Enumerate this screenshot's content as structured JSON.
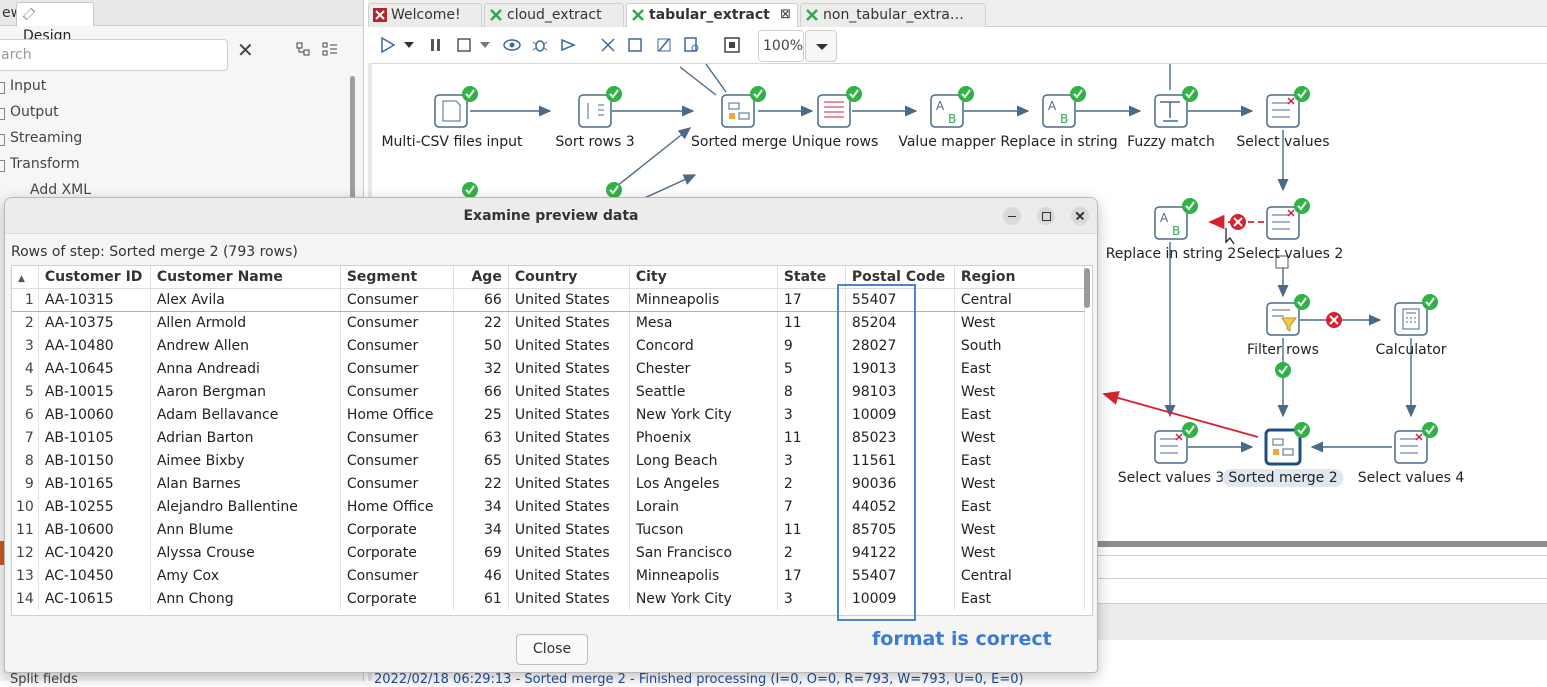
{
  "left_panel": {
    "tab_view": "ew",
    "tab_design": "Design",
    "search_placeholder": "arch",
    "tree": [
      "Input",
      "Output",
      "Streaming",
      "Transform",
      "Add XML"
    ],
    "bottom_item": "Split fields"
  },
  "tabs": [
    {
      "label": "Welcome!"
    },
    {
      "label": "cloud_extract"
    },
    {
      "label": "tabular_extract"
    },
    {
      "label": "non_tabular_extra…"
    }
  ],
  "toolbar": {
    "icons": [
      "run-icon",
      "run-dropdown-icon",
      "pause-icon",
      "stop-icon",
      "stop-dropdown-icon",
      "preview-icon",
      "debug-icon",
      "replay-icon",
      "verify-icon",
      "impact-icon",
      "sql-icon",
      "explore-db-icon",
      "grid-icon"
    ],
    "zoom": "100%"
  },
  "steps": {
    "multi_csv": "Multi-CSV files input",
    "sort_rows_3": "Sort rows 3",
    "sorted_merge": "Sorted merge",
    "unique_rows": "Unique rows",
    "value_mapper": "Value mapper",
    "replace_in_string": "Replace in string",
    "fuzzy_match": "Fuzzy match",
    "select_values": "Select values",
    "replace_in_string_2": "Replace in string 2",
    "select_values_2": "Select values 2",
    "filter_rows": "Filter rows",
    "calculator": "Calculator",
    "select_values_3": "Select values 3",
    "sorted_merge_2": "Sorted merge 2",
    "select_values_4": "Select values 4"
  },
  "dialog": {
    "title": "Examine preview data",
    "rows_label": "Rows of step: Sorted merge 2 (793 rows)",
    "close_label": "Close",
    "columns": [
      "Customer ID",
      "Customer Name",
      "Segment",
      "Age",
      "Country",
      "City",
      "State",
      "Postal Code",
      "Region"
    ],
    "rows": [
      [
        "1",
        "AA-10315",
        "Alex Avila",
        "Consumer",
        "66",
        "United States",
        "Minneapolis",
        "17",
        "55407",
        "Central"
      ],
      [
        "2",
        "AA-10375",
        "Allen Armold",
        "Consumer",
        "22",
        "United States",
        "Mesa",
        "11",
        "85204",
        "West"
      ],
      [
        "3",
        "AA-10480",
        "Andrew Allen",
        "Consumer",
        "50",
        "United States",
        "Concord",
        "9",
        "28027",
        "South"
      ],
      [
        "4",
        "AA-10645",
        "Anna Andreadi",
        "Consumer",
        "32",
        "United States",
        "Chester",
        "5",
        "19013",
        "East"
      ],
      [
        "5",
        "AB-10015",
        "Aaron Bergman",
        "Consumer",
        "66",
        "United States",
        "Seattle",
        "8",
        "98103",
        "West"
      ],
      [
        "6",
        "AB-10060",
        "Adam Bellavance",
        "Home Office",
        "25",
        "United States",
        "New York City",
        "3",
        "10009",
        "East"
      ],
      [
        "7",
        "AB-10105",
        "Adrian Barton",
        "Consumer",
        "63",
        "United States",
        "Phoenix",
        "11",
        "85023",
        "West"
      ],
      [
        "8",
        "AB-10150",
        "Aimee Bixby",
        "Consumer",
        "65",
        "United States",
        "Long Beach",
        "3",
        "11561",
        "East"
      ],
      [
        "9",
        "AB-10165",
        "Alan Barnes",
        "Consumer",
        "22",
        "United States",
        "Los Angeles",
        "2",
        "90036",
        "West"
      ],
      [
        "10",
        "AB-10255",
        "Alejandro Ballentine",
        "Home Office",
        "34",
        "United States",
        "Lorain",
        "7",
        "44052",
        "East"
      ],
      [
        "11",
        "AB-10600",
        "Ann Blume",
        "Corporate",
        "34",
        "United States",
        "Tucson",
        "11",
        "85705",
        "West"
      ],
      [
        "12",
        "AC-10420",
        "Alyssa Crouse",
        "Corporate",
        "69",
        "United States",
        "San Francisco",
        "2",
        "94122",
        "West"
      ],
      [
        "13",
        "AC-10450",
        "Amy Cox",
        "Consumer",
        "46",
        "United States",
        "Minneapolis",
        "17",
        "55407",
        "Central"
      ],
      [
        "14",
        "AC-10615",
        "Ann Chong",
        "Corporate",
        "61",
        "United States",
        "New York City",
        "3",
        "10009",
        "East"
      ]
    ]
  },
  "annotation": "format is correct",
  "log_line": "2022/02/18 06:29:13 - Sorted merge 2 - Finished processing (I=0, O=0, R=793, W=793, U=0, E=0)",
  "colors": {
    "accent": "#3a7bd5",
    "ok_green": "#2fb344",
    "error_red": "#d9202e",
    "hop": "#4a6a88"
  }
}
